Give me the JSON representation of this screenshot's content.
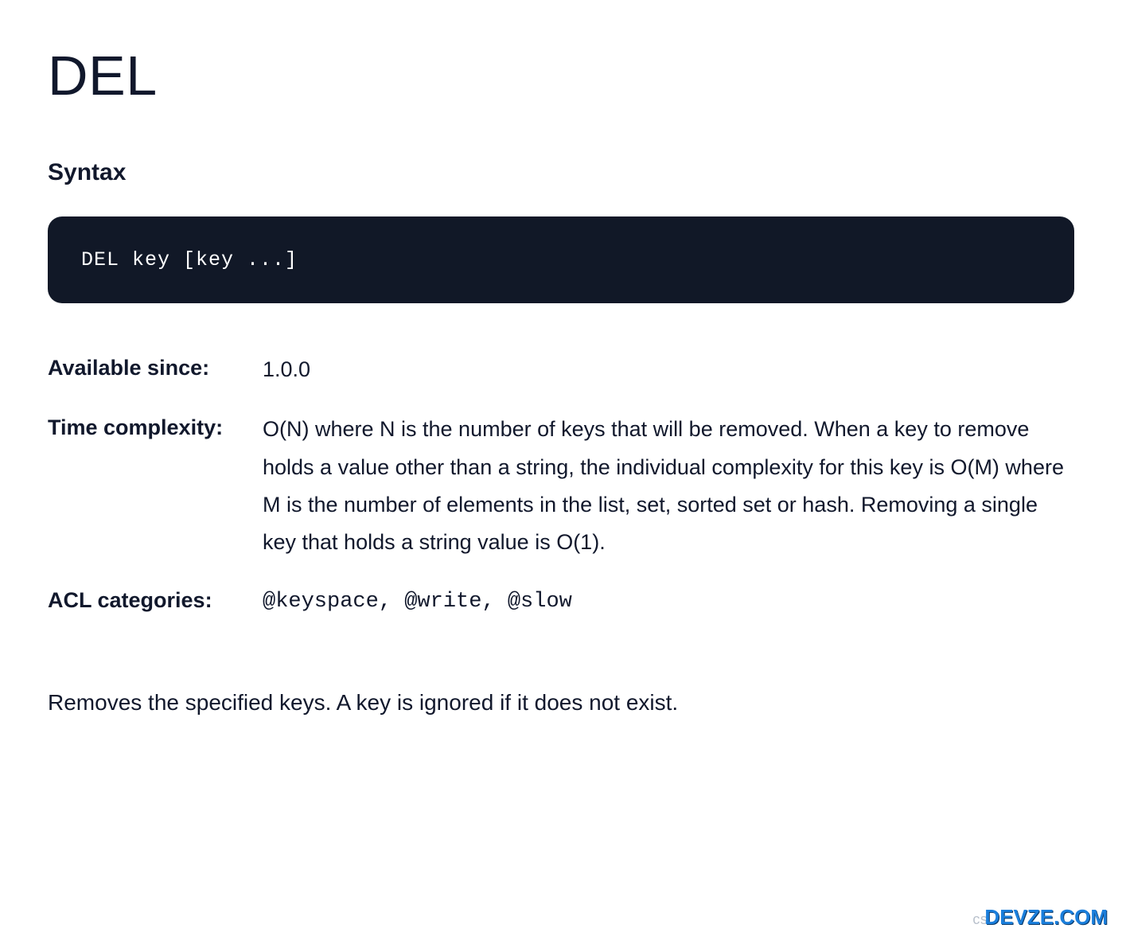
{
  "title": "DEL",
  "syntax": {
    "heading": "Syntax",
    "code": "DEL key [key ...]"
  },
  "meta": {
    "available_since": {
      "label": "Available since:",
      "value": "1.0.0"
    },
    "time_complexity": {
      "label": "Time complexity:",
      "value": "O(N) where N is the number of keys that will be removed. When a key to remove holds a value other than a string, the individual complexity for this key is O(M) where M is the number of elements in the list, set, sorted set or hash. Removing a single key that holds a string value is O(1)."
    },
    "acl_categories": {
      "label": "ACL categories:",
      "value": "@keyspace, @write, @slow"
    }
  },
  "description": "Removes the specified keys. A key is ignored if it does not exist.",
  "watermark": {
    "prefix": "cs",
    "brand": "DEVZE.COM"
  }
}
